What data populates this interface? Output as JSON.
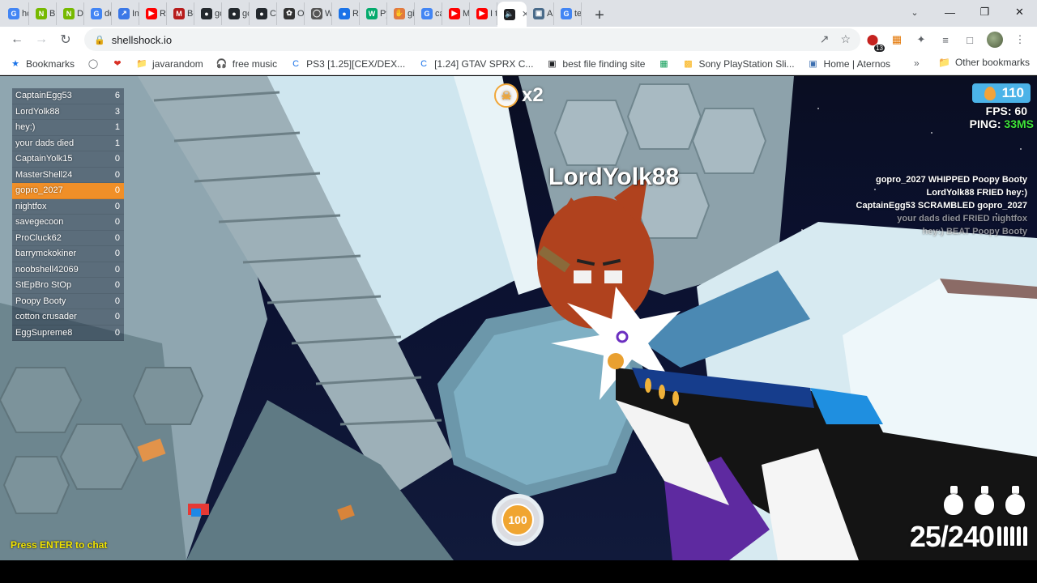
{
  "browser": {
    "tabs": [
      {
        "label": "hc",
        "icon": "google-icon",
        "color": "#4285f4"
      },
      {
        "label": "Bu",
        "icon": "nvidia-icon",
        "color": "#76b900"
      },
      {
        "label": "Dc",
        "icon": "nvidia-icon",
        "color": "#76b900"
      },
      {
        "label": "de",
        "icon": "google-icon",
        "color": "#4285f4"
      },
      {
        "label": "Im",
        "icon": "chart-icon",
        "color": "#3b78e7"
      },
      {
        "label": "Ru",
        "icon": "youtube-icon",
        "color": "#ff0000"
      },
      {
        "label": "Be",
        "icon": "medium-icon",
        "color": "#b71c1c"
      },
      {
        "label": "gc",
        "icon": "github-icon",
        "color": "#24292e"
      },
      {
        "label": "gc",
        "icon": "github-icon",
        "color": "#24292e"
      },
      {
        "label": "Cl",
        "icon": "github-icon",
        "color": "#24292e"
      },
      {
        "label": "Op",
        "icon": "openai-icon",
        "color": "#333333"
      },
      {
        "label": "W",
        "icon": "globe-icon",
        "color": "#555555"
      },
      {
        "label": "Re",
        "icon": "record-icon",
        "color": "#1a73e8"
      },
      {
        "label": "Py",
        "icon": "w3schools-icon",
        "color": "#04aa6d"
      },
      {
        "label": "gi",
        "icon": "hand-icon",
        "color": "#e27a3f"
      },
      {
        "label": "ca",
        "icon": "google-icon",
        "color": "#4285f4"
      },
      {
        "label": "M",
        "icon": "youtube-icon",
        "color": "#ff0000"
      },
      {
        "label": "I t",
        "icon": "youtube-icon",
        "color": "#ff0000"
      },
      {
        "label": "",
        "icon": "speaker-icon",
        "color": "#202124",
        "active": true
      },
      {
        "label": "A",
        "icon": "image-icon",
        "color": "#4a6b8a"
      },
      {
        "label": "te",
        "icon": "google-icon",
        "color": "#4285f4"
      }
    ],
    "url": "shellshock.io",
    "bookmarks": [
      {
        "label": "Bookmarks",
        "icon": "star-icon"
      },
      {
        "label": "",
        "icon": "globe-icon"
      },
      {
        "label": "",
        "icon": "heart-icon"
      },
      {
        "label": "javarandom",
        "icon": "folder-icon"
      },
      {
        "label": "free music",
        "icon": "headphones-icon"
      },
      {
        "label": "PS3 [1.25][CEX/DEX...",
        "icon": "site-icon"
      },
      {
        "label": "[1.24] GTAV SPRX C...",
        "icon": "site-icon"
      },
      {
        "label": "best file finding site",
        "icon": "file-icon"
      },
      {
        "label": "",
        "icon": "app-icon"
      },
      {
        "label": "Sony PlayStation Sli...",
        "icon": "bag-icon"
      },
      {
        "label": "Home | Aternos",
        "icon": "aternos-icon"
      }
    ],
    "other_bookmarks": "Other bookmarks",
    "extension_badge": "13"
  },
  "game": {
    "scoreboard": [
      {
        "name": "CaptainEgg53",
        "score": "6"
      },
      {
        "name": "LordYolk88",
        "score": "3"
      },
      {
        "name": "hey:)",
        "score": "1"
      },
      {
        "name": "your dads died",
        "score": "1"
      },
      {
        "name": "CaptainYolk15",
        "score": "0"
      },
      {
        "name": "MasterShell24",
        "score": "0"
      },
      {
        "name": "gopro_2027",
        "score": "0",
        "me": true
      },
      {
        "name": "nightfox",
        "score": "0"
      },
      {
        "name": "savegecoon",
        "score": "0"
      },
      {
        "name": "ProCluck62",
        "score": "0"
      },
      {
        "name": "barrymckokiner",
        "score": "0"
      },
      {
        "name": "noobshell42069",
        "score": "0"
      },
      {
        "name": "StEpBro StOp",
        "score": "0"
      },
      {
        "name": "Poopy Booty",
        "score": "0"
      },
      {
        "name": "cotton crusader",
        "score": "0"
      },
      {
        "name": "EggSupreme8",
        "score": "0"
      }
    ],
    "killfeed": [
      {
        "text": "gopro_2027 WHIPPED Poopy Booty",
        "faded": false
      },
      {
        "text": "LordYolk88 FRIED hey:)",
        "faded": false
      },
      {
        "text": "CaptainEgg53 SCRAMBLED gopro_2027",
        "faded": false
      },
      {
        "text": "your dads died FRIED nightfox",
        "faded": true
      },
      {
        "text": "hey:) BEAT Poopy Booty",
        "faded": true
      }
    ],
    "eggs": "110",
    "fps_label": "FPS: 60",
    "ping_label": "PING: ",
    "ping_value": "33MS",
    "streak": "x2",
    "enemy_name": "LordYolk88",
    "health": "100",
    "ammo": "25/240",
    "grenades": 3,
    "chat_hint": "Press ENTER to chat",
    "colors": {
      "me_row": "#f08f28",
      "ping": "#3ee33a",
      "chat": "#f2e400",
      "egg_button": "#4bb3e8"
    }
  }
}
